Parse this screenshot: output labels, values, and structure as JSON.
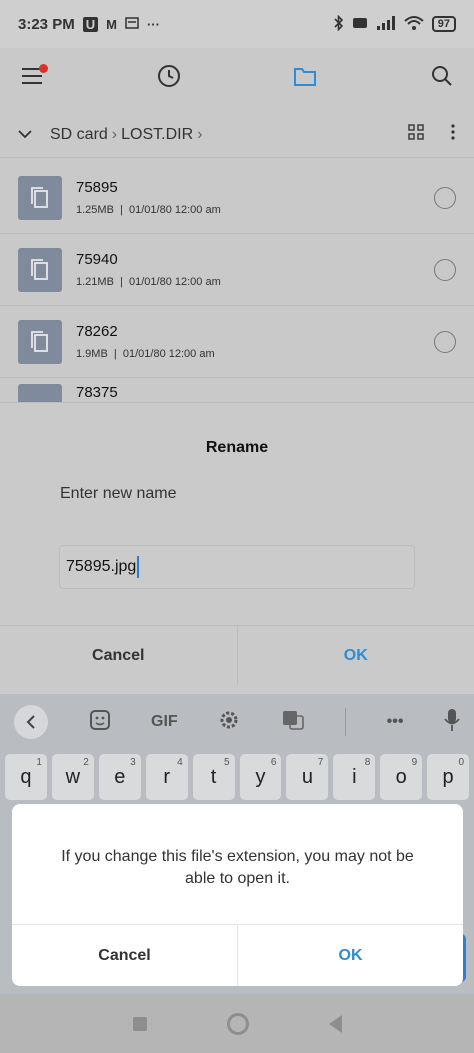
{
  "status_bar": {
    "time": "3:23 PM",
    "notif_icons": [
      "U",
      "M"
    ],
    "dots": "···",
    "battery": "97"
  },
  "toolbar": {
    "icons": [
      "menu-icon",
      "history-icon",
      "folder-icon",
      "search-icon"
    ]
  },
  "breadcrumb": {
    "items": [
      "SD card",
      "LOST.DIR"
    ],
    "separator": "›"
  },
  "files": [
    {
      "name": "75895",
      "size": "1.25MB",
      "date": "01/01/80 12:00 am"
    },
    {
      "name": "75940",
      "size": "1.21MB",
      "date": "01/01/80 12:00 am"
    },
    {
      "name": "78262",
      "size": "1.9MB",
      "date": "01/01/80 12:00 am"
    },
    {
      "name": "78375",
      "size": "",
      "date": ""
    }
  ],
  "rename_dialog": {
    "title": "Rename",
    "label": "Enter new name",
    "value": "75895.jpg",
    "cancel_label": "Cancel",
    "ok_label": "OK"
  },
  "keyboard": {
    "toolbar": [
      "back-icon",
      "sticker-icon",
      "GIF",
      "settings-icon",
      "translate-icon",
      "···",
      "mic-icon"
    ],
    "gif_label": "GIF",
    "more_label": "•••",
    "row1": [
      {
        "key": "q",
        "num": "1"
      },
      {
        "key": "w",
        "num": "2"
      },
      {
        "key": "e",
        "num": "3"
      },
      {
        "key": "r",
        "num": "4"
      },
      {
        "key": "t",
        "num": "5"
      },
      {
        "key": "y",
        "num": "6"
      },
      {
        "key": "u",
        "num": "7"
      },
      {
        "key": "i",
        "num": "8"
      },
      {
        "key": "o",
        "num": "9"
      },
      {
        "key": "p",
        "num": "0"
      }
    ]
  },
  "warning_dialog": {
    "message": "If you change this file's extension, you may not be able to open it.",
    "cancel_label": "Cancel",
    "ok_label": "OK"
  },
  "colors": {
    "accent": "#2e8bd6",
    "notification_dot": "#d9302a",
    "thumb": "#7f8b9c"
  }
}
